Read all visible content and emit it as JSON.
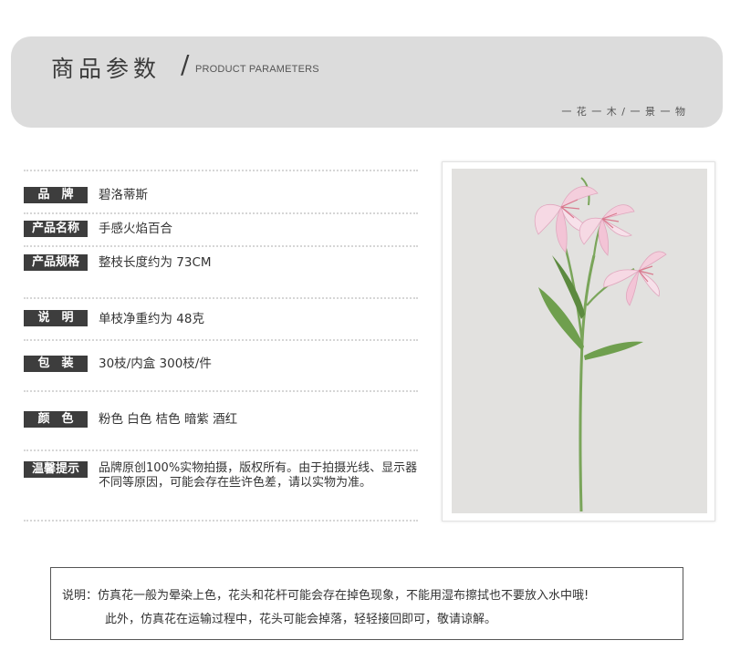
{
  "header": {
    "title": "商品参数",
    "slash": "/",
    "subtitle": "PRODUCT PARAMETERS",
    "tagline": "一 花 一 木 / 一 景 一 物"
  },
  "specs": {
    "brand": {
      "label": "品　牌",
      "value": "碧洛蒂斯"
    },
    "name": {
      "label": "产品名称",
      "value": "手感火焰百合"
    },
    "size": {
      "label": "产品规格",
      "value": "整枝长度约为 73CM"
    },
    "weight": {
      "label": "说　明",
      "value": "单枝净重约为 48克"
    },
    "packing": {
      "label": "包　装",
      "value": "30枝/内盒 300枝/件"
    },
    "colors": {
      "label": "颜　色",
      "value": "粉色 白色 桔色 暗紫 酒红"
    },
    "notice": {
      "label": "温馨提示",
      "value": "品牌原创100%实物拍摄，版权所有。由于拍摄光线、显示器不同等原因，可能会存在些许色差，请以实物为准。"
    }
  },
  "photo": {
    "subject": "flame-lily-stem-image",
    "background_color": "#e2e1df",
    "petal_color": "#f6d9e4",
    "stem_color": "#7aa55a"
  },
  "note": {
    "line1": "说明：仿真花一般为晕染上色，花头和花杆可能会存在掉色现象，不能用湿布擦拭也不要放入水中哦!",
    "line2": "此外，仿真花在运输过程中，花头可能会掉落，轻轻接回即可，敬请谅解。"
  }
}
